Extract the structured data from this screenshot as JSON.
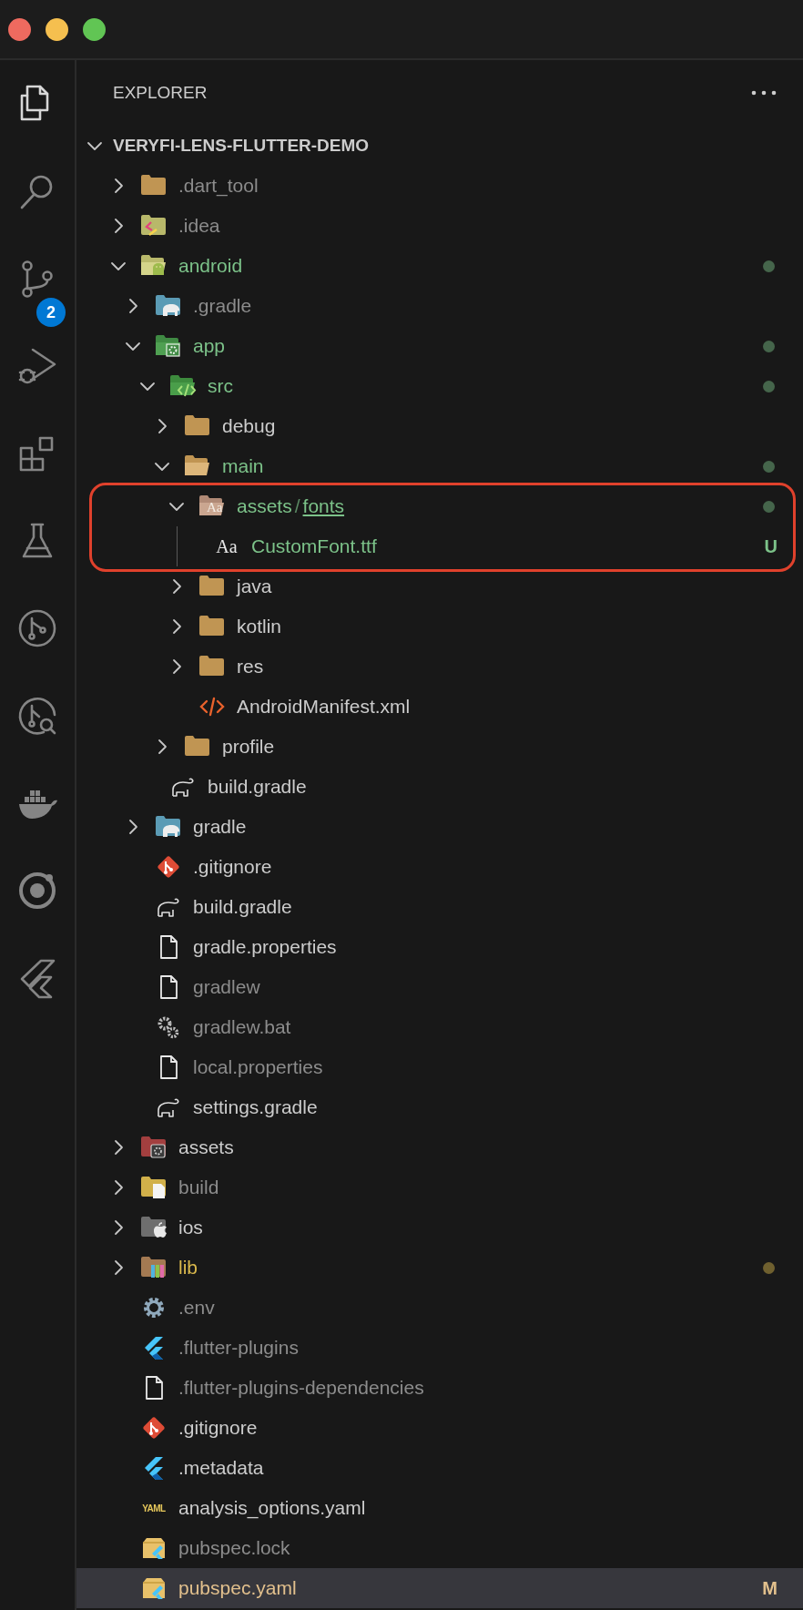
{
  "activity_bar": [
    {
      "kind": "files",
      "selected": true
    },
    {
      "kind": "search",
      "selected": false
    },
    {
      "kind": "scm",
      "selected": false,
      "badge": "2"
    },
    {
      "kind": "debug",
      "selected": false
    },
    {
      "kind": "extensions",
      "selected": false
    },
    {
      "kind": "testing",
      "selected": false
    },
    {
      "kind": "pullrequest",
      "selected": false
    },
    {
      "kind": "gitlens",
      "selected": false
    },
    {
      "kind": "docker",
      "selected": false
    },
    {
      "kind": "ionic",
      "selected": false
    },
    {
      "kind": "flutter",
      "selected": false
    }
  ],
  "explorer": {
    "title": "EXPLORER",
    "root": {
      "name": "VERYFI-LENS-FLUTTER-DEMO",
      "expanded": true,
      "children": [
        {
          "name": ".dart_tool",
          "kind": "folder",
          "expanded": false,
          "color": "#8c8c8c",
          "selected": false
        },
        {
          "name": ".idea",
          "kind": "ideafolder",
          "expanded": false,
          "color": "#8c8c8c",
          "selected": false
        },
        {
          "name": "android",
          "kind": "androidfolder",
          "expanded": true,
          "color": "#7cc289",
          "dot": true,
          "selected": false,
          "children": [
            {
              "name": ".gradle",
              "kind": "gradlefolder",
              "expanded": false,
              "color": "#8c8c8c",
              "selected": false
            },
            {
              "name": "app",
              "kind": "appfolder",
              "expanded": true,
              "color": "#7cc289",
              "dot": true,
              "selected": false,
              "children": [
                {
                  "name": "src",
                  "kind": "srcfolder",
                  "expanded": true,
                  "color": "#7cc289",
                  "dot": true,
                  "selected": false,
                  "children": [
                    {
                      "name": "debug",
                      "kind": "folder",
                      "expanded": false,
                      "color": "#cccccc",
                      "selected": false
                    },
                    {
                      "name": "main",
                      "kind": "folder",
                      "expanded": true,
                      "color": "#7cc289",
                      "dot": true,
                      "selected": false,
                      "children": [
                        {
                          "segments": [
                            {
                              "text": "assets",
                              "underlined": false
                            },
                            {
                              "text": "fonts",
                              "underlined": true
                            }
                          ],
                          "separator": "/",
                          "kind": "fontfolder",
                          "icon_text": "Aa",
                          "expanded": true,
                          "color": "#7cc289",
                          "dot": true,
                          "callout": true,
                          "guides": true,
                          "selected": false,
                          "children": [
                            {
                              "name": "CustomFont.ttf",
                              "kind": "fontfile",
                              "icon_text": "Aa",
                              "color": "#7cc289",
                              "badge": "U",
                              "callout": true,
                              "selected": false
                            }
                          ]
                        },
                        {
                          "name": "java",
                          "kind": "folder",
                          "expanded": false,
                          "color": "#cccccc",
                          "selected": false
                        },
                        {
                          "name": "kotlin",
                          "kind": "folder",
                          "expanded": false,
                          "color": "#cccccc",
                          "selected": false
                        },
                        {
                          "name": "res",
                          "kind": "folder",
                          "expanded": false,
                          "color": "#cccccc",
                          "selected": false
                        },
                        {
                          "name": "AndroidManifest.xml",
                          "kind": "xml",
                          "color": "#cccccc",
                          "selected": false
                        }
                      ]
                    },
                    {
                      "name": "profile",
                      "kind": "folder",
                      "expanded": false,
                      "color": "#cccccc",
                      "selected": false
                    }
                  ]
                },
                {
                  "name": "build.gradle",
                  "kind": "gradlefile",
                  "color": "#cccccc",
                  "selected": false
                }
              ]
            },
            {
              "name": "gradle",
              "kind": "gradlefolder",
              "expanded": false,
              "color": "#cccccc",
              "selected": false
            },
            {
              "name": ".gitignore",
              "kind": "git",
              "color": "#cccccc",
              "selected": false
            },
            {
              "name": "build.gradle",
              "kind": "gradlefile",
              "color": "#cccccc",
              "selected": false
            },
            {
              "name": "gradle.properties",
              "kind": "file",
              "color": "#cccccc",
              "selected": false
            },
            {
              "name": "gradlew",
              "kind": "file",
              "color": "#8c8c8c",
              "selected": false
            },
            {
              "name": "gradlew.bat",
              "kind": "gears",
              "color": "#8c8c8c",
              "selected": false
            },
            {
              "name": "local.properties",
              "kind": "file",
              "color": "#8c8c8c",
              "selected": false
            },
            {
              "name": "settings.gradle",
              "kind": "gradlefile",
              "color": "#cccccc",
              "selected": false
            }
          ]
        },
        {
          "name": "assets",
          "kind": "assetsfolder",
          "expanded": false,
          "color": "#cccccc",
          "selected": false
        },
        {
          "name": "build",
          "kind": "buildfolder",
          "expanded": false,
          "color": "#8c8c8c",
          "selected": false
        },
        {
          "name": "ios",
          "kind": "iosfolder",
          "expanded": false,
          "color": "#cccccc",
          "selected": false
        },
        {
          "name": "lib",
          "kind": "libfolder",
          "expanded": false,
          "color": "#d9b84c",
          "dot": true,
          "selected": false
        },
        {
          "name": ".env",
          "kind": "gear",
          "color": "#8c8c8c",
          "selected": false
        },
        {
          "name": ".flutter-plugins",
          "kind": "flutter",
          "color": "#8c8c8c",
          "selected": false
        },
        {
          "name": ".flutter-plugins-dependencies",
          "kind": "file",
          "color": "#8c8c8c",
          "selected": false
        },
        {
          "name": ".gitignore",
          "kind": "git",
          "color": "#cccccc",
          "selected": false
        },
        {
          "name": ".metadata",
          "kind": "flutter",
          "color": "#cccccc",
          "selected": false
        },
        {
          "name": "analysis_options.yaml",
          "kind": "yaml",
          "icon_text": "YAML",
          "color": "#cccccc",
          "selected": false
        },
        {
          "name": "pubspec.lock",
          "kind": "pubspec",
          "color": "#8c8c8c",
          "selected": false
        },
        {
          "name": "pubspec.yaml",
          "kind": "pubspec",
          "color": "#e2c08d",
          "badge": "M",
          "selected": true
        }
      ]
    }
  }
}
